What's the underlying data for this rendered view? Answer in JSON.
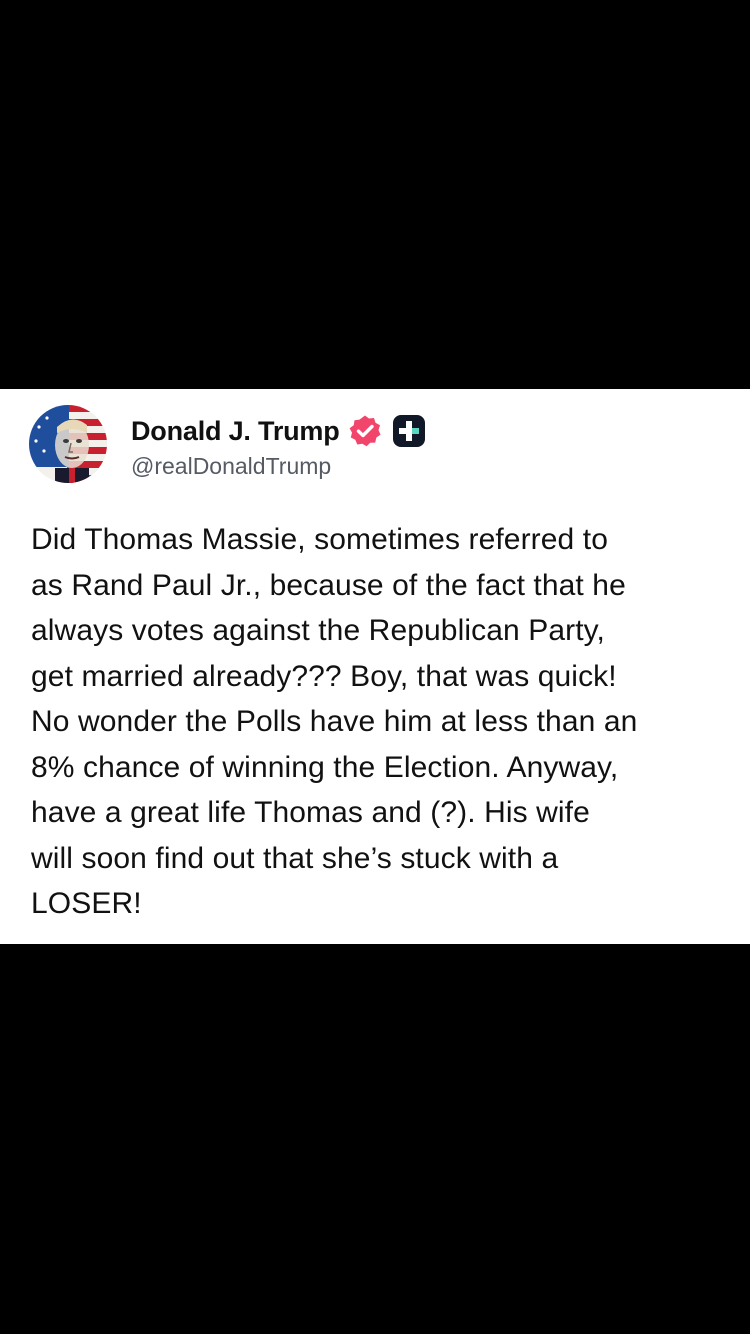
{
  "post": {
    "display_name": "Donald J. Trump",
    "handle": "@realDonaldTrump",
    "avatar_icon": "avatar-flag-portrait",
    "badges": {
      "verified_icon": "verified-badge-icon",
      "verified_color": "#f2456b",
      "plus_icon": "truth-plus-icon"
    },
    "text_lines": [
      "Did Thomas Massie, sometimes referred to",
      "as Rand Paul Jr., because of the fact that he",
      "always votes against the Republican Party,",
      "get married already??? Boy, that was quick!",
      "No wonder the Polls have him at less than an",
      "8% chance of winning the Election. Anyway,",
      "have a great life Thomas and (?). His wife",
      "will soon find out that she’s stuck with a",
      "LOSER!"
    ]
  },
  "colors": {
    "background": "#000000",
    "card": "#ffffff",
    "text": "#111111",
    "handle": "#555a63"
  }
}
